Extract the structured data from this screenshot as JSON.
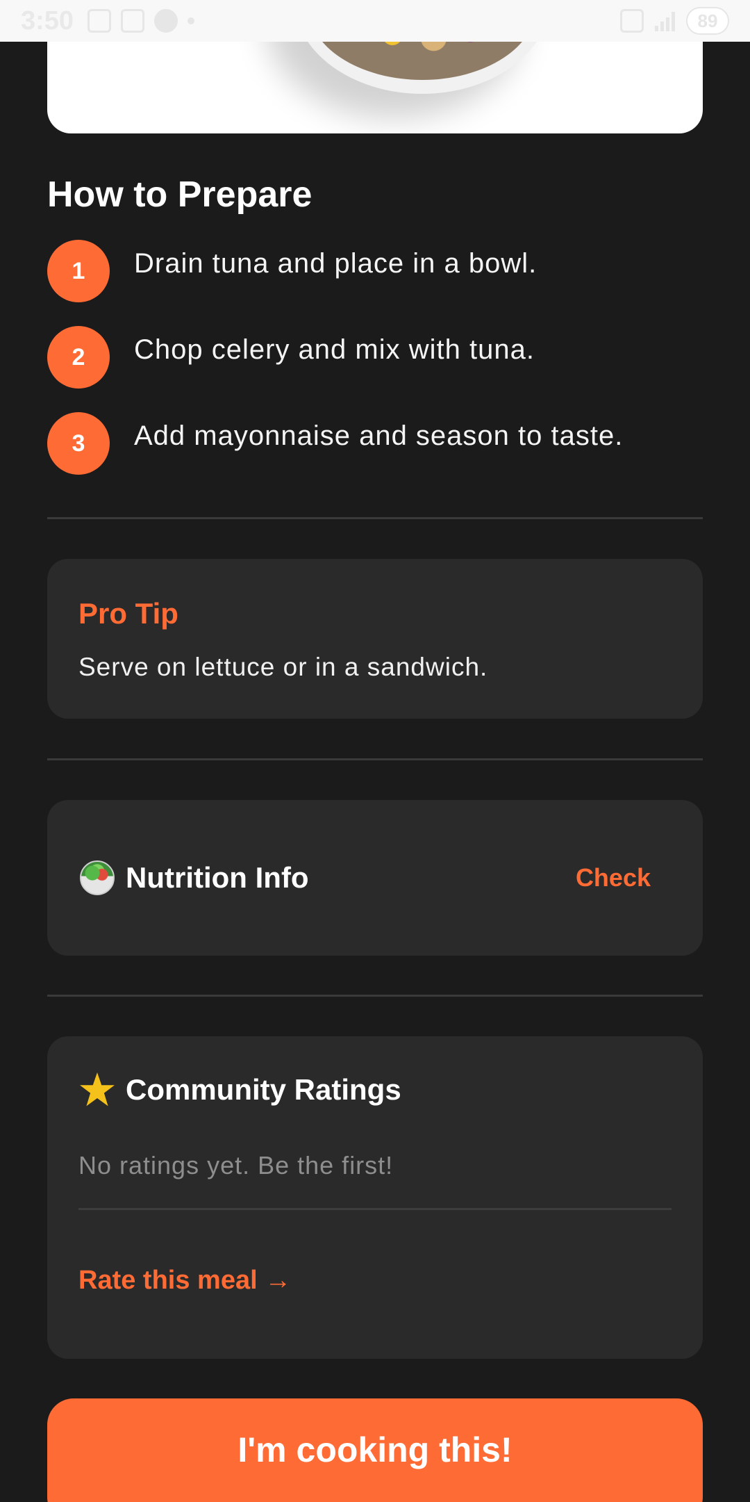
{
  "status_bar": {
    "time": "3:50",
    "battery": "89"
  },
  "section": {
    "title": "How to Prepare"
  },
  "steps": [
    {
      "number": "1",
      "text": "Drain tuna and place in a bowl."
    },
    {
      "number": "2",
      "text": "Chop celery and mix with tuna."
    },
    {
      "number": "3",
      "text": "Add mayonnaise and season to taste."
    }
  ],
  "pro_tip": {
    "title": "Pro Tip",
    "text": "Serve on lettuce or in a sandwich."
  },
  "nutrition": {
    "icon": "salad-icon",
    "title": "Nutrition Info",
    "action_label": "Check"
  },
  "ratings": {
    "icon": "star-icon",
    "title": "Community Ratings",
    "empty_text": "No ratings yet. Be the first!",
    "action_label": "Rate this meal →"
  },
  "cta": {
    "label": "I'm cooking this!"
  },
  "colors": {
    "background": "#1b1b1b",
    "card": "#2a2a2a",
    "accent": "#ff6b35",
    "muted_text": "#8e8e8e"
  }
}
